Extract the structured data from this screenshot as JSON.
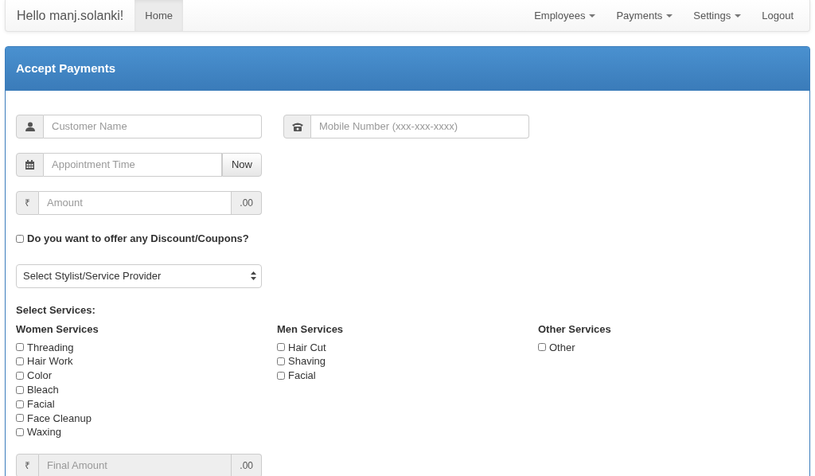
{
  "navbar": {
    "brand": "Hello manj.solanki!",
    "left_items": [
      {
        "label": "Home",
        "selected": true
      }
    ],
    "right_items": [
      {
        "label": "Employees",
        "dropdown": true
      },
      {
        "label": "Payments",
        "dropdown": true
      },
      {
        "label": "Settings",
        "dropdown": true
      },
      {
        "label": "Logout",
        "dropdown": false
      }
    ]
  },
  "panel": {
    "title": "Accept Payments"
  },
  "customer_name": {
    "placeholder": "Customer Name"
  },
  "mobile": {
    "placeholder": "Mobile Number (xxx-xxx-xxxx)"
  },
  "appointment": {
    "placeholder": "Appointment Time",
    "button": "Now"
  },
  "amount": {
    "prefix": "₹",
    "placeholder": "Amount",
    "suffix": ".00",
    "disabled": false
  },
  "discount": {
    "label": "Do you want to offer any Discount/Coupons?",
    "checked": false
  },
  "stylist_select": {
    "value": "Select Stylist/Service Provider"
  },
  "services": {
    "title": "Select Services:",
    "groups": [
      {
        "title": "Women Services",
        "items": [
          {
            "label": "Threading",
            "checked": false
          },
          {
            "label": "Hair Work",
            "checked": false
          },
          {
            "label": "Color",
            "checked": false
          },
          {
            "label": "Bleach",
            "checked": false
          },
          {
            "label": "Facial",
            "checked": false
          },
          {
            "label": "Face Cleanup",
            "checked": false
          },
          {
            "label": "Waxing",
            "checked": false
          }
        ]
      },
      {
        "title": "Men Services",
        "items": [
          {
            "label": "Hair Cut",
            "checked": false
          },
          {
            "label": "Shaving",
            "checked": false
          },
          {
            "label": "Facial",
            "checked": false
          }
        ]
      },
      {
        "title": "Other Services",
        "items": [
          {
            "label": "Other",
            "checked": false
          }
        ]
      }
    ]
  },
  "final_amount": {
    "prefix": "₹",
    "placeholder": "Final Amount",
    "suffix": ".00",
    "disabled": true
  }
}
